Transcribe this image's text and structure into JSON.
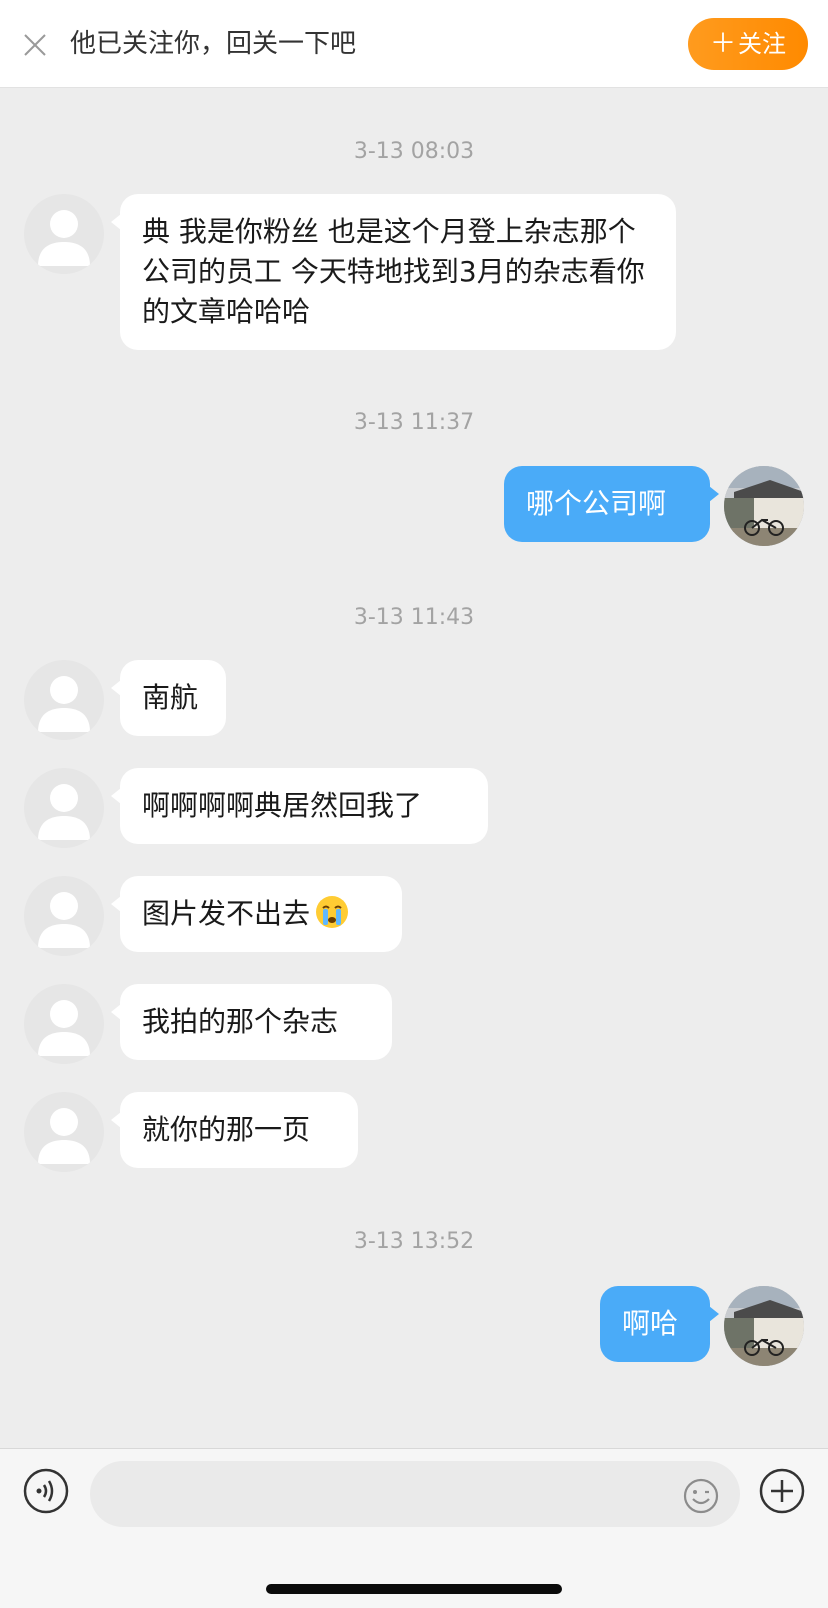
{
  "banner": {
    "text": "他已关注你，回关一下吧",
    "follow_label": "关注",
    "follow_plus": "＋",
    "accent": "#ff8c00"
  },
  "chat": {
    "timestamps": [
      "3-13 08:03",
      "3-13 11:37",
      "3-13 11:43",
      "3-13 13:52"
    ],
    "messages": [
      {
        "from": "other",
        "text": "典 我是你粉丝 也是这个月登上杂志那个公司的员工 今天特地找到3月的杂志看你的文章哈哈哈"
      },
      {
        "from": "me",
        "text": "哪个公司啊"
      },
      {
        "from": "other",
        "text": "南航"
      },
      {
        "from": "other",
        "text": "啊啊啊啊典居然回我了"
      },
      {
        "from": "other",
        "text": "图片发不出去",
        "emoji": "crying-face"
      },
      {
        "from": "other",
        "text": "我拍的那个杂志"
      },
      {
        "from": "other",
        "text": "就你的那一页"
      },
      {
        "from": "me",
        "text": "啊哈"
      }
    ],
    "incoming_bubble_color": "#ffffff",
    "outgoing_bubble_color": "#4aabf8"
  },
  "composer": {
    "input_value": "",
    "icons": [
      "voice-icon",
      "emoji-icon",
      "add-icon"
    ]
  }
}
